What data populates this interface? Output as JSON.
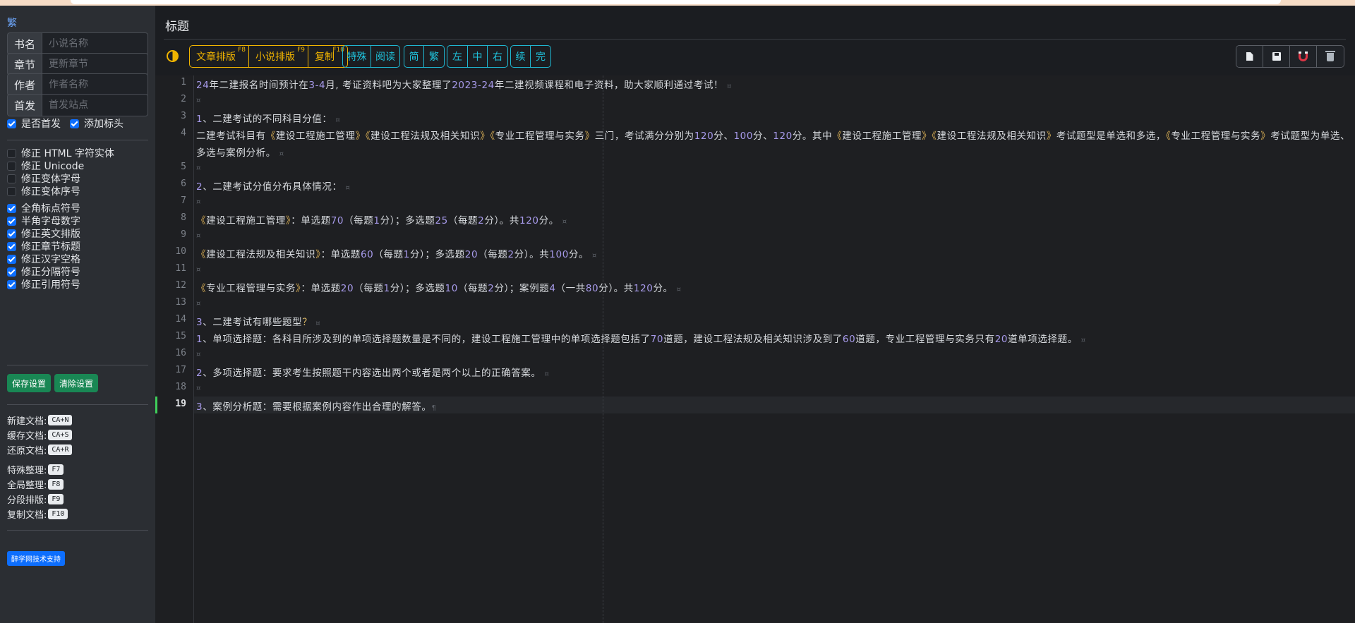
{
  "sidebar": {
    "logo": "繁",
    "fields": [
      {
        "label": "书名",
        "placeholder": "小说名称",
        "value": ""
      },
      {
        "label": "章节",
        "placeholder": "更新章节",
        "value": ""
      },
      {
        "label": "作者",
        "placeholder": "作者名称",
        "value": ""
      },
      {
        "label": "首发",
        "placeholder": "首发站点",
        "value": ""
      }
    ],
    "options_a": [
      {
        "label": "是否首发",
        "checked": true
      },
      {
        "label": "添加标头",
        "checked": true
      }
    ],
    "options_b": [
      {
        "label": "修正 HTML 字符实体",
        "checked": false
      },
      {
        "label": "修正 Unicode",
        "checked": false
      },
      {
        "label": "修正变体字母",
        "checked": false
      },
      {
        "label": "修正变体序号",
        "checked": false
      }
    ],
    "options_c": [
      {
        "label": "全角标点符号",
        "checked": true
      },
      {
        "label": "半角字母数字",
        "checked": true
      },
      {
        "label": "修正英文排版",
        "checked": true
      },
      {
        "label": "修正章节标题",
        "checked": true
      },
      {
        "label": "修正汉字空格",
        "checked": true
      },
      {
        "label": "修正分隔符号",
        "checked": true
      },
      {
        "label": "修正引用符号",
        "checked": true
      }
    ],
    "save_settings": "保存设置",
    "clear_settings": "清除设置",
    "shortcuts_a": [
      {
        "label": "新建文档:",
        "key": "CA+N"
      },
      {
        "label": "缓存文档:",
        "key": "CA+S"
      },
      {
        "label": "还原文档:",
        "key": "CA+R"
      }
    ],
    "shortcuts_b": [
      {
        "label": "特殊整理:",
        "key": "F7"
      },
      {
        "label": "全局整理:",
        "key": "F8"
      },
      {
        "label": "分段排版:",
        "key": "F9"
      },
      {
        "label": "复制文档:",
        "key": "F10"
      }
    ],
    "support": "醉学网技术支持"
  },
  "main": {
    "title": "标题",
    "toolbar": {
      "article_layout": "文章排版",
      "article_key": "F8",
      "novel_layout": "小说排版",
      "novel_key": "F9",
      "copy": "复制",
      "copy_key": "F10",
      "special": "特殊",
      "read": "阅读",
      "simplified": "简",
      "traditional": "繁",
      "left": "左",
      "center": "中",
      "right": "右",
      "continue": "续",
      "finish": "完"
    }
  },
  "editor": {
    "active_line": 19,
    "line_numbers": [
      "1",
      "2",
      "3",
      "4",
      "5",
      "6",
      "7",
      "8",
      "9",
      "10",
      "11",
      "12",
      "13",
      "14",
      "15",
      "16",
      "17",
      "18",
      "19"
    ],
    "lines": {
      "l1": "24年二建报名时间预计在3-4月, 考证资料吧为大家整理了2023-24年二建视频课程和电子资料，助大家顺利通过考试！",
      "l3": "1、二建考试的不同科目分值：",
      "l4": "二建考试科目有《建设工程施工管理》《建设工程法规及相关知识》《专业工程管理与实务》三门，考试满分分别为120分、100分、120分。其中《建设工程施工管理》《建设工程法规及相关知识》考试题型是单选和多选，《专业工程管理与实务》考试题型为单选、多选与案例分析。",
      "l6": "2、二建考试分值分布具体情况：",
      "l8": "《建设工程施工管理》：单选题70（每题1分）；多选题25（每题2分）。共120分。",
      "l10": "《建设工程法规及相关知识》：单选题60（每题1分）；多选题20（每题2分）。共100分。",
      "l12": "《专业工程管理与实务》：单选题20（每题1分）；多选题10（每题2分）；案例题4（一共80分）。共120分。",
      "l14": "3、二建考试有哪些题型？",
      "l15": "1、单项选择题：各科目所涉及到的单项选择题数量是不同的，建设工程施工管理中的单项选择题包括了70道题，建设工程法规及相关知识涉及到了60道题，专业工程管理与实务只有20道单项选择题。",
      "l17": "2、多项选择题：要求考生按照题干内容选出两个或者是两个以上的正确答案。",
      "l19": "3、案例分析题：需要根据案例内容作出合理的解答。"
    },
    "eol_mark": "¤",
    "cursor_mark": "¶"
  }
}
